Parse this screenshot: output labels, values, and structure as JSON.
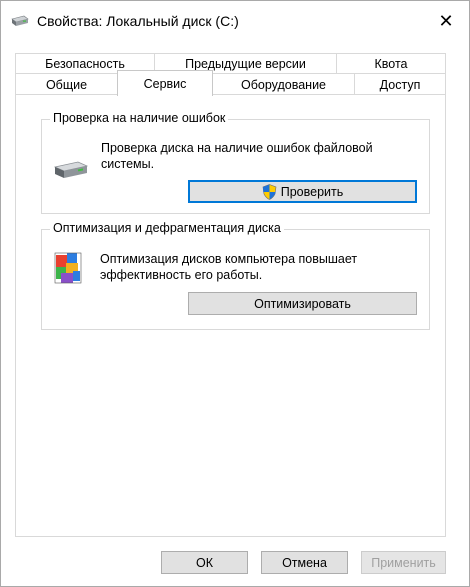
{
  "window": {
    "title": "Свойства: Локальный диск (C:)",
    "close_glyph": "✕"
  },
  "tabs": {
    "row1": [
      {
        "label": "Безопасность"
      },
      {
        "label": "Предыдущие версии"
      },
      {
        "label": "Квота"
      }
    ],
    "row2": [
      {
        "label": "Общие"
      },
      {
        "label": "Сервис",
        "active": true
      },
      {
        "label": "Оборудование"
      },
      {
        "label": "Доступ"
      }
    ]
  },
  "error_check": {
    "title": "Проверка на наличие ошибок",
    "description_line1": "Проверка диска на наличие ошибок файловой",
    "description_line2": "системы.",
    "button_label": "Проверить",
    "icon": "hard-drive-icon"
  },
  "optimize": {
    "title": "Оптимизация и дефрагментация диска",
    "description_line1": "Оптимизация дисков компьютера повышает",
    "description_line2": "эффективность его работы.",
    "button_label": "Оптимизировать",
    "icon": "defrag-icon"
  },
  "footer": {
    "ok_label": "ОК",
    "cancel_label": "Отмена",
    "apply_label": "Применить"
  },
  "colors": {
    "focus": "#0078d7",
    "border": "#d9d9d9",
    "button_bg": "#e1e1e1"
  }
}
